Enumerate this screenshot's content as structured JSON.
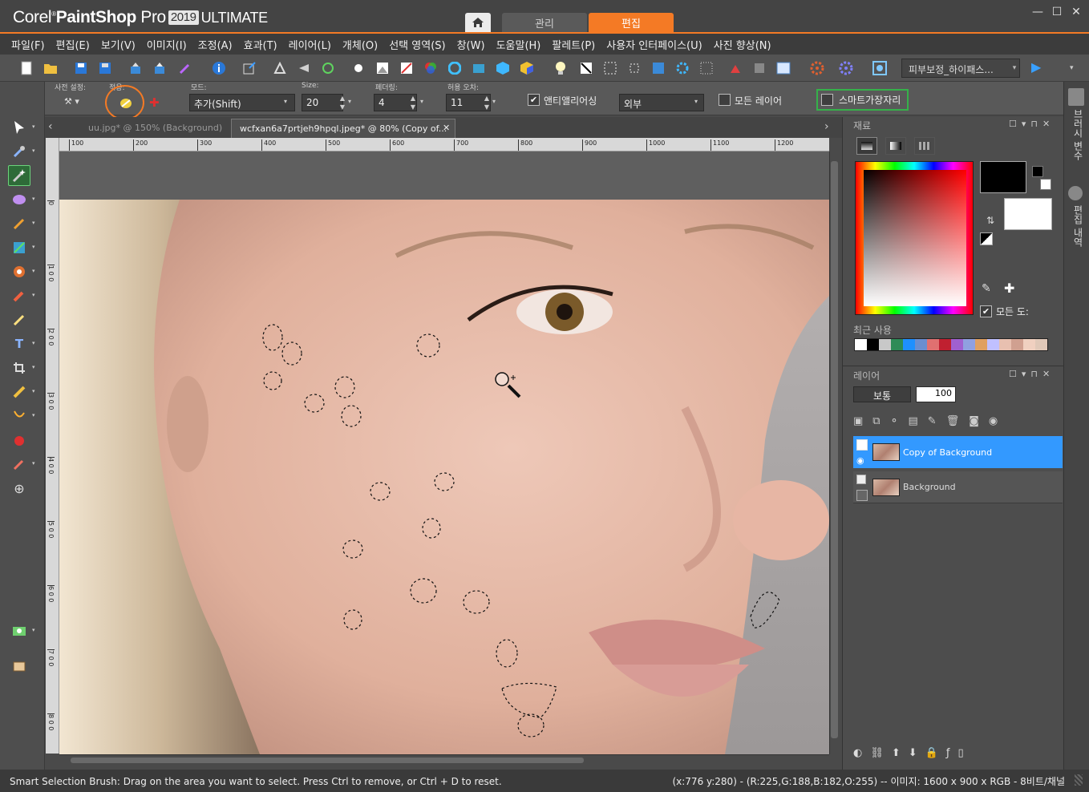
{
  "app": {
    "title_light": "Corel",
    "title_bold": "PaintShop",
    "title_pro": "Pro",
    "version": "2019",
    "edition": "ULTIMATE"
  },
  "tabs": {
    "manage": "관리",
    "edit": "편집"
  },
  "window_controls": {
    "minimize": "—",
    "restore": "☐",
    "close": "✕"
  },
  "menu": [
    "파일(F)",
    "편집(E)",
    "보기(V)",
    "이미지(I)",
    "조정(A)",
    "효과(T)",
    "레이어(L)",
    "개체(O)",
    "선택 영역(S)",
    "창(W)",
    "도움말(H)",
    "팔레트(P)",
    "사용자 인터페이스(U)",
    "사진 향상(N)"
  ],
  "toolbar": {
    "workspace": "피부보정_하이패스...",
    "workspace_arrow": "▾"
  },
  "options": {
    "preset_label": "사전 설정:",
    "apply_label": "적용:",
    "mode_label": "모드:",
    "mode_value": "추가(Shift)",
    "size_label": "Size:",
    "size_value": "20",
    "feather_label": "페더링:",
    "feather_value": "4",
    "tolerance_label": "허용 오차:",
    "tolerance_value": "11",
    "antialias_label": "앤티앨리어싱",
    "antialias_checked": true,
    "outside_value": "외부",
    "all_layers_label": "모든 레이어",
    "smart_edge_label": "스마트가장자리"
  },
  "doctabs": {
    "inactive": "uu.jpg* @ 150% (Background)",
    "active": "wcfxan6a7prtjeh9hpql.jpeg* @  80% (Copy of...",
    "close": "✕"
  },
  "ruler": {
    "h": [
      "100",
      "200",
      "300",
      "400",
      "500",
      "600",
      "700",
      "800",
      "900",
      "1000",
      "1100",
      "1200"
    ],
    "v": [
      "0",
      "1 0 0",
      "2 0 0",
      "3 0 0",
      "4 0 0",
      "5 0 0",
      "6 0 0",
      "7 0 0",
      "8 0 0"
    ]
  },
  "materials": {
    "title": "재료",
    "all_tools_label": "모든 도:",
    "recent_label": "최근 사용",
    "recent_colors": [
      "#ffffff",
      "#000000",
      "#c8c8c8",
      "#2e8b57",
      "#1e90ff",
      "#6a8ed0",
      "#e07070",
      "#c02030",
      "#a060d0",
      "#90a0e0",
      "#e0a060",
      "#c0c0ff",
      "#e8c0b0",
      "#d0a090",
      "#f0d0c0",
      "#e0c8b8"
    ]
  },
  "layers": {
    "title": "레이어",
    "blend_mode": "보통",
    "opacity": "100",
    "items": [
      {
        "name": "Copy of Background",
        "selected": true
      },
      {
        "name": "Background",
        "selected": false
      }
    ]
  },
  "side_strip": [
    "브러시 변수",
    "편집 내역"
  ],
  "status": {
    "hint": "Smart Selection Brush: Drag on the area you want to select. Press Ctrl to remove, or Ctrl + D to reset.",
    "info": "(x:776 y:280) - (R:225,G:188,B:182,O:255) -- 이미지:  1600 x 900 x RGB - 8비트/채널"
  }
}
